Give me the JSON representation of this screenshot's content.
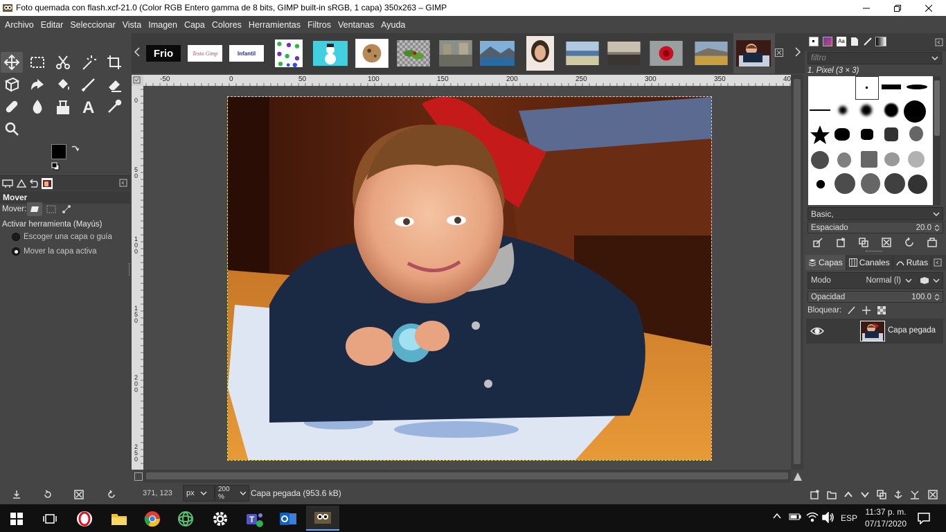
{
  "window": {
    "title": "Foto quemada con flash.xcf-21.0 (Color RGB Entero gamma de 8 bits, GIMP built-in sRGB, 1 capa) 350x263 – GIMP"
  },
  "menu": [
    "Archivo",
    "Editar",
    "Seleccionar",
    "Vista",
    "Imagen",
    "Capa",
    "Colores",
    "Herramientas",
    "Filtros",
    "Ventanas",
    "Ayuda"
  ],
  "image_tabs": [
    {
      "label": "Frio",
      "bg": "#0a0a0a",
      "fg": "#ffffff"
    },
    {
      "label": "Texto Gimp",
      "bg": "#ffffff",
      "fg": "#c04060"
    },
    {
      "label": "Infantil",
      "bg": "#ffffff",
      "fg": "#2030a0"
    }
  ],
  "toolbox": {
    "tools": [
      "move-icon",
      "rect-select-icon",
      "scissors-icon",
      "fuzzy-select-icon",
      "crop-icon",
      "unified-transform-icon",
      "warp-icon",
      "bucket-fill-icon",
      "paintbrush-icon",
      "eraser-icon",
      "heal-icon",
      "smudge-icon",
      "clone-icon",
      "text-icon",
      "color-picker-icon",
      "zoom-icon"
    ],
    "fg_color": "#000000",
    "bg_color": "#ffffff"
  },
  "tool_options": {
    "title": "Mover",
    "mover_label": "Mover:",
    "toggle_label": "Activar herramienta  (Mayús)",
    "options": [
      "Escoger una capa o guía",
      "Mover la capa activa"
    ],
    "selected_option": 1
  },
  "ruler": {
    "h_labels": [
      "-50",
      "0",
      "50",
      "100",
      "150",
      "200",
      "250",
      "300",
      "350",
      "40"
    ],
    "v_labels": [
      "0",
      "5 0",
      "1 0 0",
      "1 5 0",
      "2 0 0",
      "2 5 0"
    ]
  },
  "status": {
    "coords": "371, 123",
    "unit": "px",
    "zoom": "200 %",
    "layer_info": "Capa pegada (953.6 kB)"
  },
  "brushes": {
    "filter_placeholder": "filtro",
    "selected_brush": "1. Pixel (3 × 3)",
    "tag": "Basic,",
    "spacing_label": "Espaciado",
    "spacing_value": "20.0"
  },
  "layers": {
    "tabs": [
      "Capas",
      "Canales",
      "Rutas"
    ],
    "mode_label": "Modo",
    "mode_value": "Normal (l)",
    "opacity_label": "Opacidad",
    "opacity_value": "100.0",
    "lock_label": "Bloquear:",
    "items": [
      {
        "name": "Capa pegada",
        "visible": true
      }
    ]
  },
  "taskbar": {
    "language": "ESP",
    "time": "11:37 p. m.",
    "date": "07/17/2020"
  }
}
